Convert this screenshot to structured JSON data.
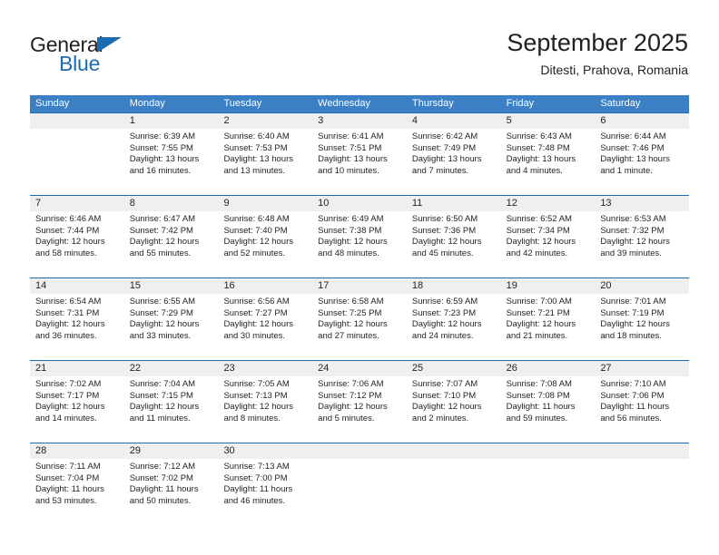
{
  "brand": {
    "name_part1": "General",
    "name_part2": "Blue",
    "triangle_color": "#1b6cb0"
  },
  "header": {
    "title": "September 2025",
    "subtitle": "Ditesti, Prahova, Romania"
  },
  "theme": {
    "header_blue": "#3b7fc4",
    "rule_blue": "#1b6cb0",
    "daynum_band": "#efefef",
    "text": "#231f20"
  },
  "weekdays": [
    "Sunday",
    "Monday",
    "Tuesday",
    "Wednesday",
    "Thursday",
    "Friday",
    "Saturday"
  ],
  "weeks": [
    [
      {
        "day": "",
        "sunrise": "",
        "sunset": "",
        "daylight": "",
        "empty": true
      },
      {
        "day": "1",
        "sunrise": "Sunrise: 6:39 AM",
        "sunset": "Sunset: 7:55 PM",
        "daylight": "Daylight: 13 hours and 16 minutes."
      },
      {
        "day": "2",
        "sunrise": "Sunrise: 6:40 AM",
        "sunset": "Sunset: 7:53 PM",
        "daylight": "Daylight: 13 hours and 13 minutes."
      },
      {
        "day": "3",
        "sunrise": "Sunrise: 6:41 AM",
        "sunset": "Sunset: 7:51 PM",
        "daylight": "Daylight: 13 hours and 10 minutes."
      },
      {
        "day": "4",
        "sunrise": "Sunrise: 6:42 AM",
        "sunset": "Sunset: 7:49 PM",
        "daylight": "Daylight: 13 hours and 7 minutes."
      },
      {
        "day": "5",
        "sunrise": "Sunrise: 6:43 AM",
        "sunset": "Sunset: 7:48 PM",
        "daylight": "Daylight: 13 hours and 4 minutes."
      },
      {
        "day": "6",
        "sunrise": "Sunrise: 6:44 AM",
        "sunset": "Sunset: 7:46 PM",
        "daylight": "Daylight: 13 hours and 1 minute."
      }
    ],
    [
      {
        "day": "7",
        "sunrise": "Sunrise: 6:46 AM",
        "sunset": "Sunset: 7:44 PM",
        "daylight": "Daylight: 12 hours and 58 minutes."
      },
      {
        "day": "8",
        "sunrise": "Sunrise: 6:47 AM",
        "sunset": "Sunset: 7:42 PM",
        "daylight": "Daylight: 12 hours and 55 minutes."
      },
      {
        "day": "9",
        "sunrise": "Sunrise: 6:48 AM",
        "sunset": "Sunset: 7:40 PM",
        "daylight": "Daylight: 12 hours and 52 minutes."
      },
      {
        "day": "10",
        "sunrise": "Sunrise: 6:49 AM",
        "sunset": "Sunset: 7:38 PM",
        "daylight": "Daylight: 12 hours and 48 minutes."
      },
      {
        "day": "11",
        "sunrise": "Sunrise: 6:50 AM",
        "sunset": "Sunset: 7:36 PM",
        "daylight": "Daylight: 12 hours and 45 minutes."
      },
      {
        "day": "12",
        "sunrise": "Sunrise: 6:52 AM",
        "sunset": "Sunset: 7:34 PM",
        "daylight": "Daylight: 12 hours and 42 minutes."
      },
      {
        "day": "13",
        "sunrise": "Sunrise: 6:53 AM",
        "sunset": "Sunset: 7:32 PM",
        "daylight": "Daylight: 12 hours and 39 minutes."
      }
    ],
    [
      {
        "day": "14",
        "sunrise": "Sunrise: 6:54 AM",
        "sunset": "Sunset: 7:31 PM",
        "daylight": "Daylight: 12 hours and 36 minutes."
      },
      {
        "day": "15",
        "sunrise": "Sunrise: 6:55 AM",
        "sunset": "Sunset: 7:29 PM",
        "daylight": "Daylight: 12 hours and 33 minutes."
      },
      {
        "day": "16",
        "sunrise": "Sunrise: 6:56 AM",
        "sunset": "Sunset: 7:27 PM",
        "daylight": "Daylight: 12 hours and 30 minutes."
      },
      {
        "day": "17",
        "sunrise": "Sunrise: 6:58 AM",
        "sunset": "Sunset: 7:25 PM",
        "daylight": "Daylight: 12 hours and 27 minutes."
      },
      {
        "day": "18",
        "sunrise": "Sunrise: 6:59 AM",
        "sunset": "Sunset: 7:23 PM",
        "daylight": "Daylight: 12 hours and 24 minutes."
      },
      {
        "day": "19",
        "sunrise": "Sunrise: 7:00 AM",
        "sunset": "Sunset: 7:21 PM",
        "daylight": "Daylight: 12 hours and 21 minutes."
      },
      {
        "day": "20",
        "sunrise": "Sunrise: 7:01 AM",
        "sunset": "Sunset: 7:19 PM",
        "daylight": "Daylight: 12 hours and 18 minutes."
      }
    ],
    [
      {
        "day": "21",
        "sunrise": "Sunrise: 7:02 AM",
        "sunset": "Sunset: 7:17 PM",
        "daylight": "Daylight: 12 hours and 14 minutes."
      },
      {
        "day": "22",
        "sunrise": "Sunrise: 7:04 AM",
        "sunset": "Sunset: 7:15 PM",
        "daylight": "Daylight: 12 hours and 11 minutes."
      },
      {
        "day": "23",
        "sunrise": "Sunrise: 7:05 AM",
        "sunset": "Sunset: 7:13 PM",
        "daylight": "Daylight: 12 hours and 8 minutes."
      },
      {
        "day": "24",
        "sunrise": "Sunrise: 7:06 AM",
        "sunset": "Sunset: 7:12 PM",
        "daylight": "Daylight: 12 hours and 5 minutes."
      },
      {
        "day": "25",
        "sunrise": "Sunrise: 7:07 AM",
        "sunset": "Sunset: 7:10 PM",
        "daylight": "Daylight: 12 hours and 2 minutes."
      },
      {
        "day": "26",
        "sunrise": "Sunrise: 7:08 AM",
        "sunset": "Sunset: 7:08 PM",
        "daylight": "Daylight: 11 hours and 59 minutes."
      },
      {
        "day": "27",
        "sunrise": "Sunrise: 7:10 AM",
        "sunset": "Sunset: 7:06 PM",
        "daylight": "Daylight: 11 hours and 56 minutes."
      }
    ],
    [
      {
        "day": "28",
        "sunrise": "Sunrise: 7:11 AM",
        "sunset": "Sunset: 7:04 PM",
        "daylight": "Daylight: 11 hours and 53 minutes."
      },
      {
        "day": "29",
        "sunrise": "Sunrise: 7:12 AM",
        "sunset": "Sunset: 7:02 PM",
        "daylight": "Daylight: 11 hours and 50 minutes."
      },
      {
        "day": "30",
        "sunrise": "Sunrise: 7:13 AM",
        "sunset": "Sunset: 7:00 PM",
        "daylight": "Daylight: 11 hours and 46 minutes."
      },
      {
        "day": "",
        "sunrise": "",
        "sunset": "",
        "daylight": "",
        "empty": true
      },
      {
        "day": "",
        "sunrise": "",
        "sunset": "",
        "daylight": "",
        "empty": true
      },
      {
        "day": "",
        "sunrise": "",
        "sunset": "",
        "daylight": "",
        "empty": true
      },
      {
        "day": "",
        "sunrise": "",
        "sunset": "",
        "daylight": "",
        "empty": true
      }
    ]
  ]
}
